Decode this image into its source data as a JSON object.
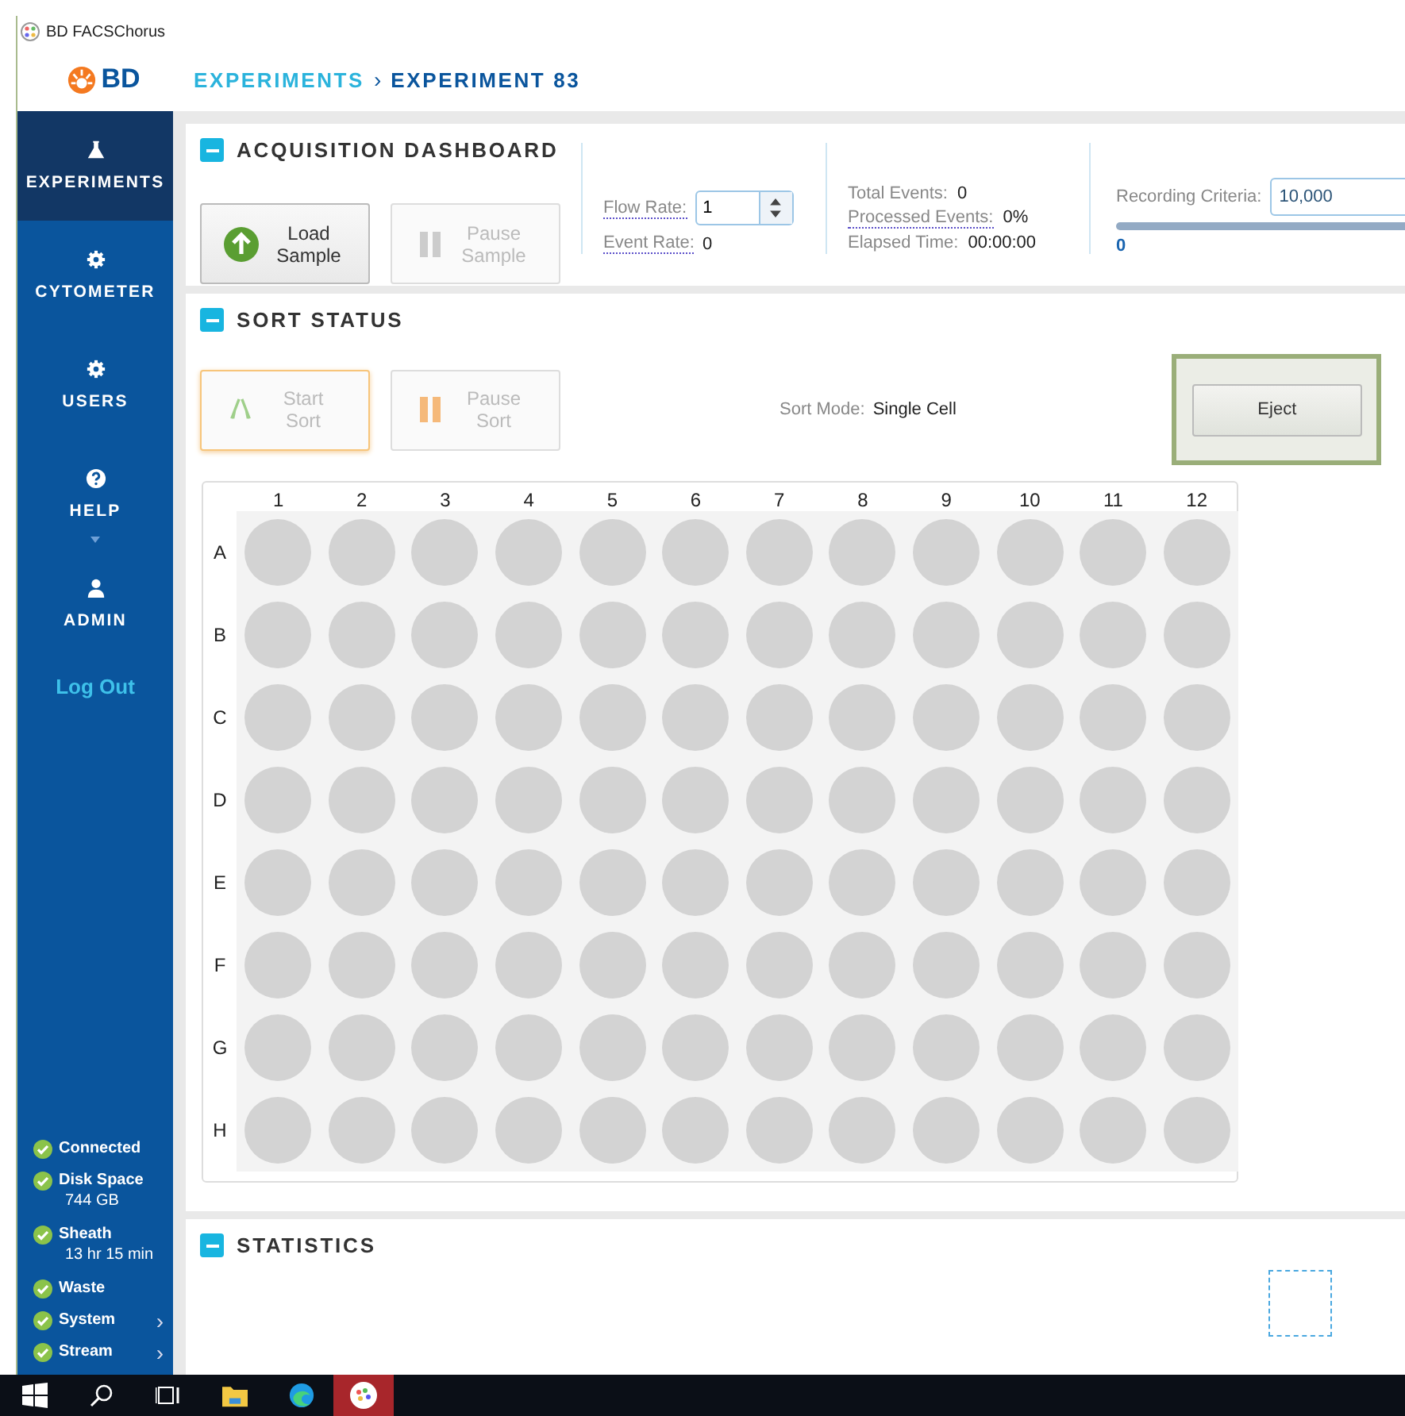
{
  "window": {
    "title": "BD FACSChorus"
  },
  "header": {
    "logo": "BD",
    "breadcrumb": [
      {
        "label": "EXPERIMENTS",
        "current": false
      },
      {
        "label": "EXPERIMENT 83",
        "current": true
      }
    ],
    "separator": "›"
  },
  "sidebar": {
    "items": [
      {
        "label": "EXPERIMENTS",
        "kind": "flask",
        "selected": true,
        "has_caret": false
      },
      {
        "label": "CYTOMETER",
        "kind": "gear",
        "selected": false,
        "has_caret": false
      },
      {
        "label": "USERS",
        "kind": "gear",
        "selected": false,
        "has_caret": false
      },
      {
        "label": "HELP",
        "kind": "question",
        "selected": false,
        "has_caret": true
      },
      {
        "label": "ADMIN",
        "kind": "person",
        "selected": false,
        "has_caret": false
      }
    ],
    "logout": "Log Out",
    "status": [
      {
        "label": "Connected",
        "ok": true
      },
      {
        "label": "Disk Space",
        "detail": "744 GB",
        "ok": true
      },
      {
        "label": "Sheath",
        "detail": "13 hr 15 min",
        "ok": true
      },
      {
        "label": "Waste",
        "ok": true
      },
      {
        "label": "System",
        "ok": true,
        "arrow": "›"
      },
      {
        "label": "Stream",
        "ok": true,
        "arrow": "›"
      }
    ]
  },
  "acquisition": {
    "title": "ACQUISITION DASHBOARD",
    "buttons": [
      {
        "label": "Load Sample",
        "kind": "up",
        "disabled": false
      },
      {
        "label": "Pause Sample",
        "kind": "pause",
        "disabled": true
      }
    ],
    "flow_rate": {
      "label": "Flow Rate:",
      "value": "1"
    },
    "event_rate": {
      "label": "Event Rate:",
      "value": "0"
    },
    "stats": [
      {
        "label": "Total Events:",
        "value": "0",
        "dotted": false
      },
      {
        "label": "Processed Events:",
        "value": "0%",
        "dotted": true
      },
      {
        "label": "Elapsed Time:",
        "value": "00:00:00",
        "dotted": false
      }
    ],
    "recording": {
      "label": "Recording Criteria:",
      "value": "10,000",
      "level": 0,
      "reading": "0"
    }
  },
  "sort_status": {
    "title": "SORT STATUS",
    "buttons": [
      {
        "label": "Start Sort",
        "kind": "sort",
        "disabled": true,
        "focused": true
      },
      {
        "label": "Pause Sort",
        "kind": "pause",
        "disabled": true,
        "focused": false
      }
    ],
    "sort_mode": {
      "label": "Sort Mode:",
      "value": "Single Cell"
    },
    "eject": {
      "label": "Eject",
      "highlighted": true
    },
    "plate": {
      "columns": [
        "1",
        "2",
        "3",
        "4",
        "5",
        "6",
        "7",
        "8",
        "9",
        "10",
        "11",
        "12"
      ],
      "rows": [
        "A",
        "B",
        "C",
        "D",
        "E",
        "F",
        "G",
        "H"
      ]
    }
  },
  "statistics": {
    "title": "STATISTICS"
  }
}
